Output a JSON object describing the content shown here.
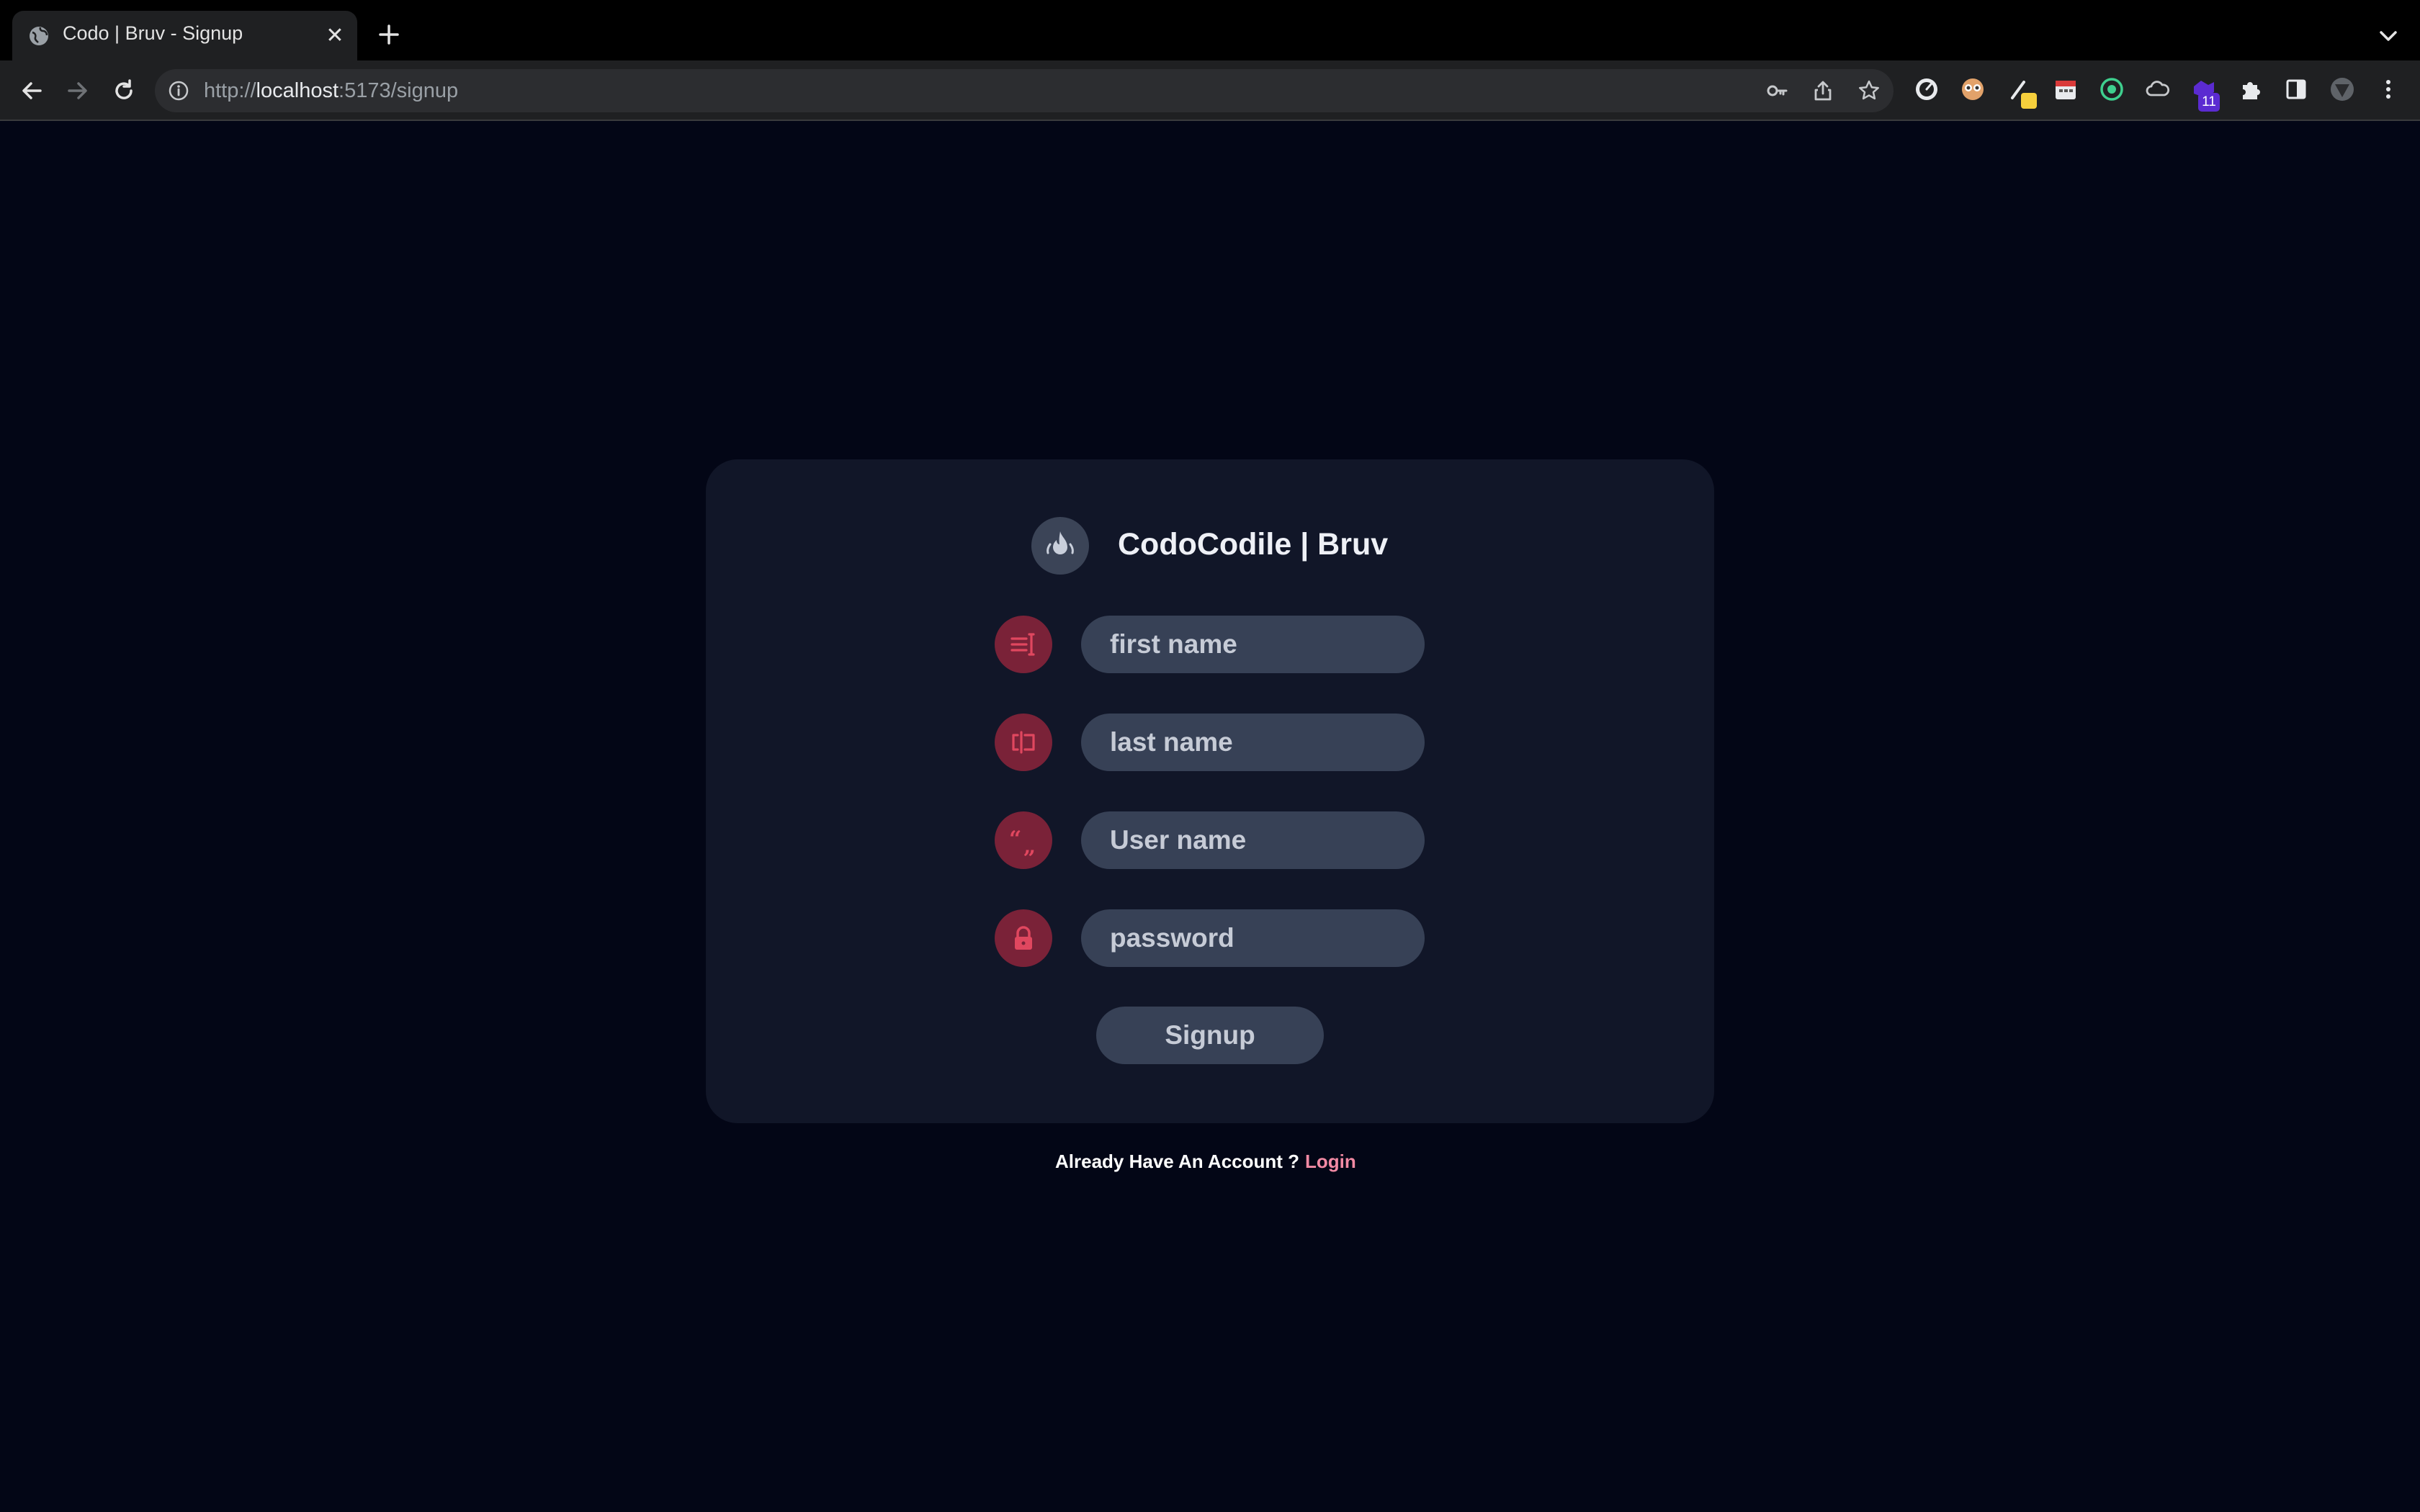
{
  "browser": {
    "tab_title": "Codo | Bruv - Signup",
    "url_scheme": "http://",
    "url_host": "localhost",
    "url_path": ":5173/signup",
    "extension_badge_count": "11"
  },
  "brand": {
    "title": "CodoCodile | Bruv",
    "logo_icon": "flame-icon"
  },
  "form": {
    "fields": [
      {
        "placeholder": "first name",
        "value": "",
        "icon": "text-cursor-icon"
      },
      {
        "placeholder": "last name",
        "value": "",
        "icon": "text-field-icon"
      },
      {
        "placeholder": "User name",
        "value": "",
        "icon": "quote-icon"
      },
      {
        "placeholder": "password",
        "value": "",
        "icon": "lock-icon"
      }
    ],
    "submit_label": "Signup"
  },
  "footer": {
    "account_prompt": "Already Have An Account ?",
    "login_label": "Login"
  },
  "colors": {
    "page_bg": "#030616",
    "card_bg": "#111628",
    "input_bg": "#374156",
    "icon_bg": "#7a2238",
    "icon_fg": "#e0475f",
    "link": "#f28aa4"
  }
}
